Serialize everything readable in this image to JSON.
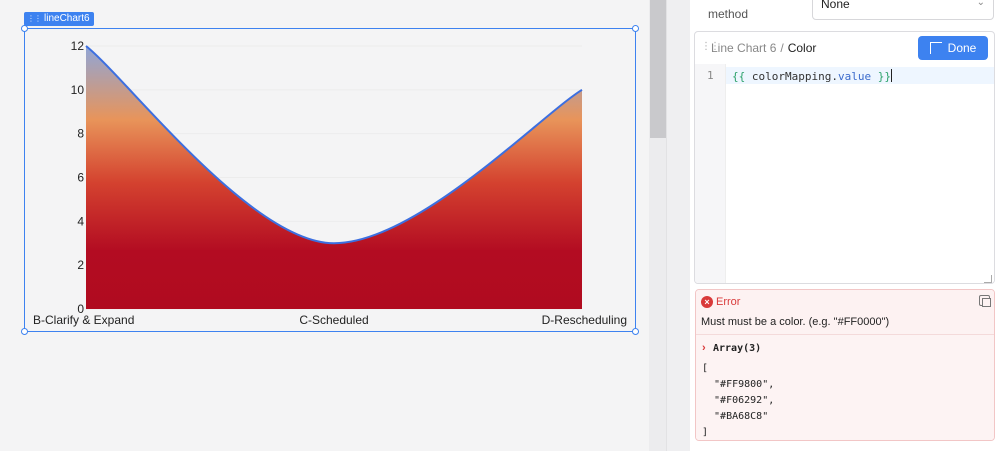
{
  "canvas": {
    "component_tag": "lineChart6"
  },
  "chart_data": {
    "type": "area",
    "categories": [
      "B-Clarify & Expand",
      "C-Scheduled",
      "D-Rescheduling"
    ],
    "values": [
      12,
      3,
      10
    ],
    "ylim": [
      0,
      12
    ],
    "yticks": [
      "0",
      "2",
      "4",
      "6",
      "8",
      "10",
      "12"
    ],
    "line_color": "#3c6fe0",
    "fill_gradient": [
      "#8fa6d8",
      "#e8945a",
      "#d4422f",
      "#b30c22",
      "#b00b1f"
    ],
    "grid": "horizontal"
  },
  "panel": {
    "method_label": "method",
    "method_label_cut": "",
    "method_value": "None",
    "editor": {
      "breadcrumb_parent": "Line Chart 6",
      "breadcrumb_separator": "/",
      "breadcrumb_current": "Color",
      "done_label": "Done",
      "line_number": "1",
      "code_open": "{{",
      "code_ident": " colorMapping",
      "code_dot": ".",
      "code_prop": "value",
      "code_close": " }}"
    },
    "error": {
      "title": "Error",
      "message": "Must must be a color. (e.g. \"#FF0000\")",
      "type": "Array(3)",
      "lines": [
        "[",
        "  \"#FF9800\",",
        "  \"#F06292\",",
        "  \"#BA68C8\"",
        "]"
      ]
    }
  },
  "colors": {
    "accent": "#3d82f0",
    "error": "#d93a3a"
  }
}
